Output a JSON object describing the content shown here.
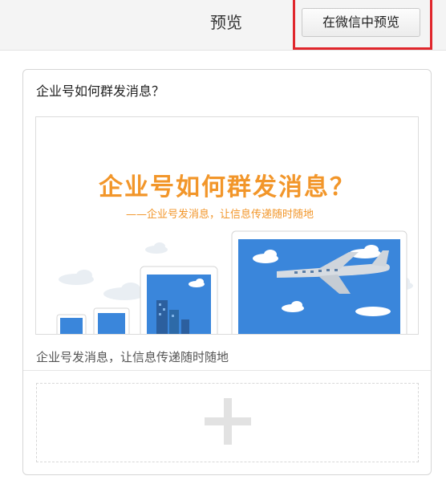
{
  "header": {
    "title": "预览",
    "preview_button_label": "在微信中预览"
  },
  "article": {
    "title": "企业号如何群发消息？",
    "cover": {
      "headline": "企业号如何群发消息？",
      "subheadline": "——企业号发消息，让信息传递随时随地"
    },
    "digest": "企业号发消息，让信息传递随时随地"
  },
  "add_article": {
    "icon": "plus-icon"
  },
  "colors": {
    "highlight": "#e0262c",
    "cover_text": "#f2962a",
    "device_screen": "#3a86db"
  }
}
